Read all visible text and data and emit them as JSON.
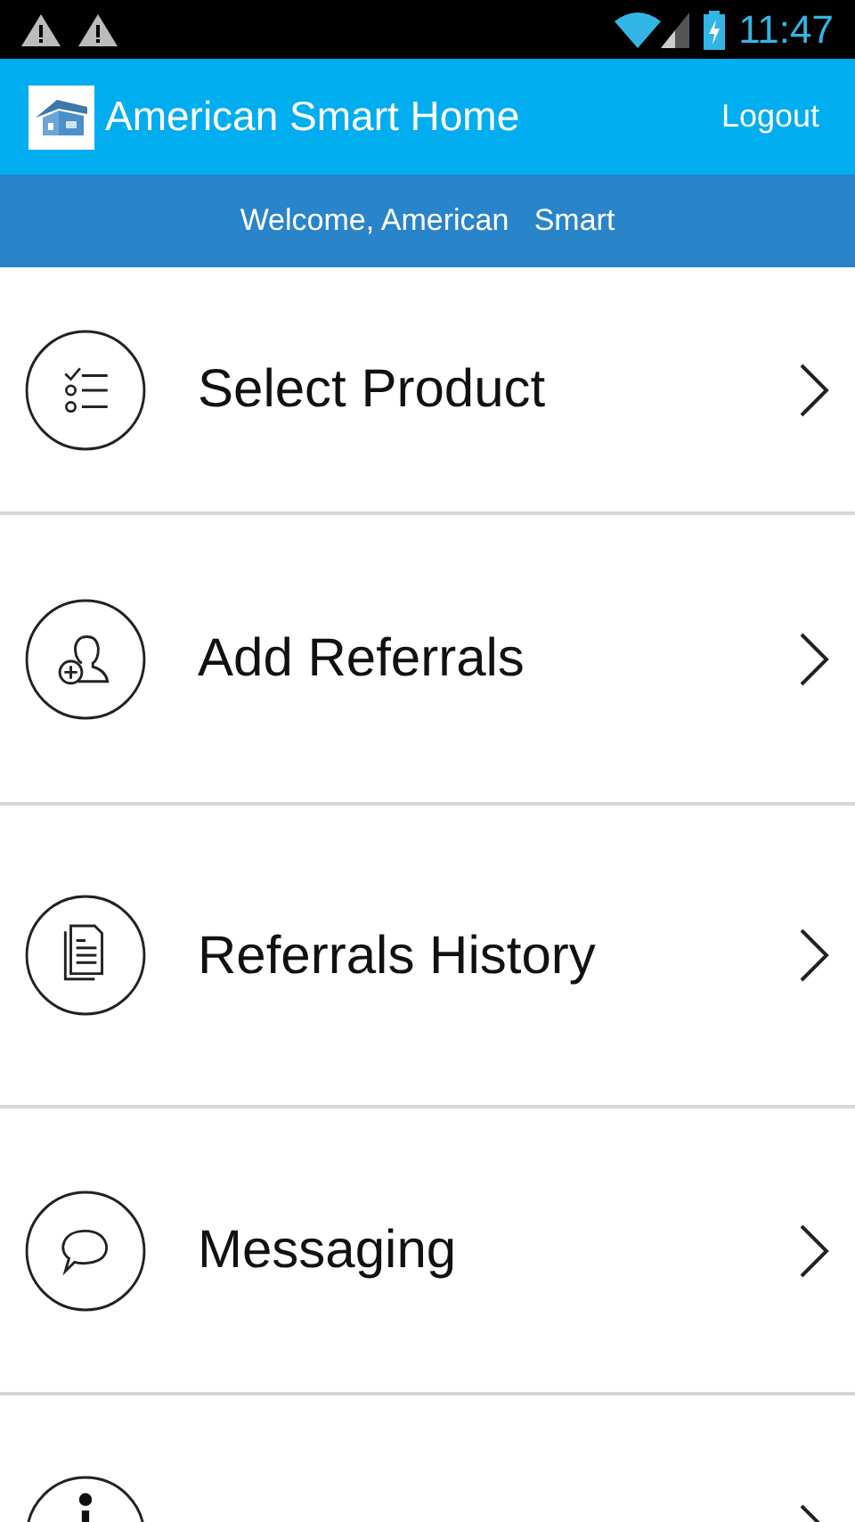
{
  "status_bar": {
    "time": "11:47"
  },
  "header": {
    "title": "American Smart Home",
    "action": "Logout"
  },
  "welcome": "Welcome, American   Smart",
  "menu": [
    {
      "kind": "checklist",
      "label": "Select Product"
    },
    {
      "kind": "person-add",
      "label": "Add Referrals"
    },
    {
      "kind": "document",
      "label": "Referrals History"
    },
    {
      "kind": "chat",
      "label": "Messaging"
    },
    {
      "kind": "info"
    }
  ]
}
